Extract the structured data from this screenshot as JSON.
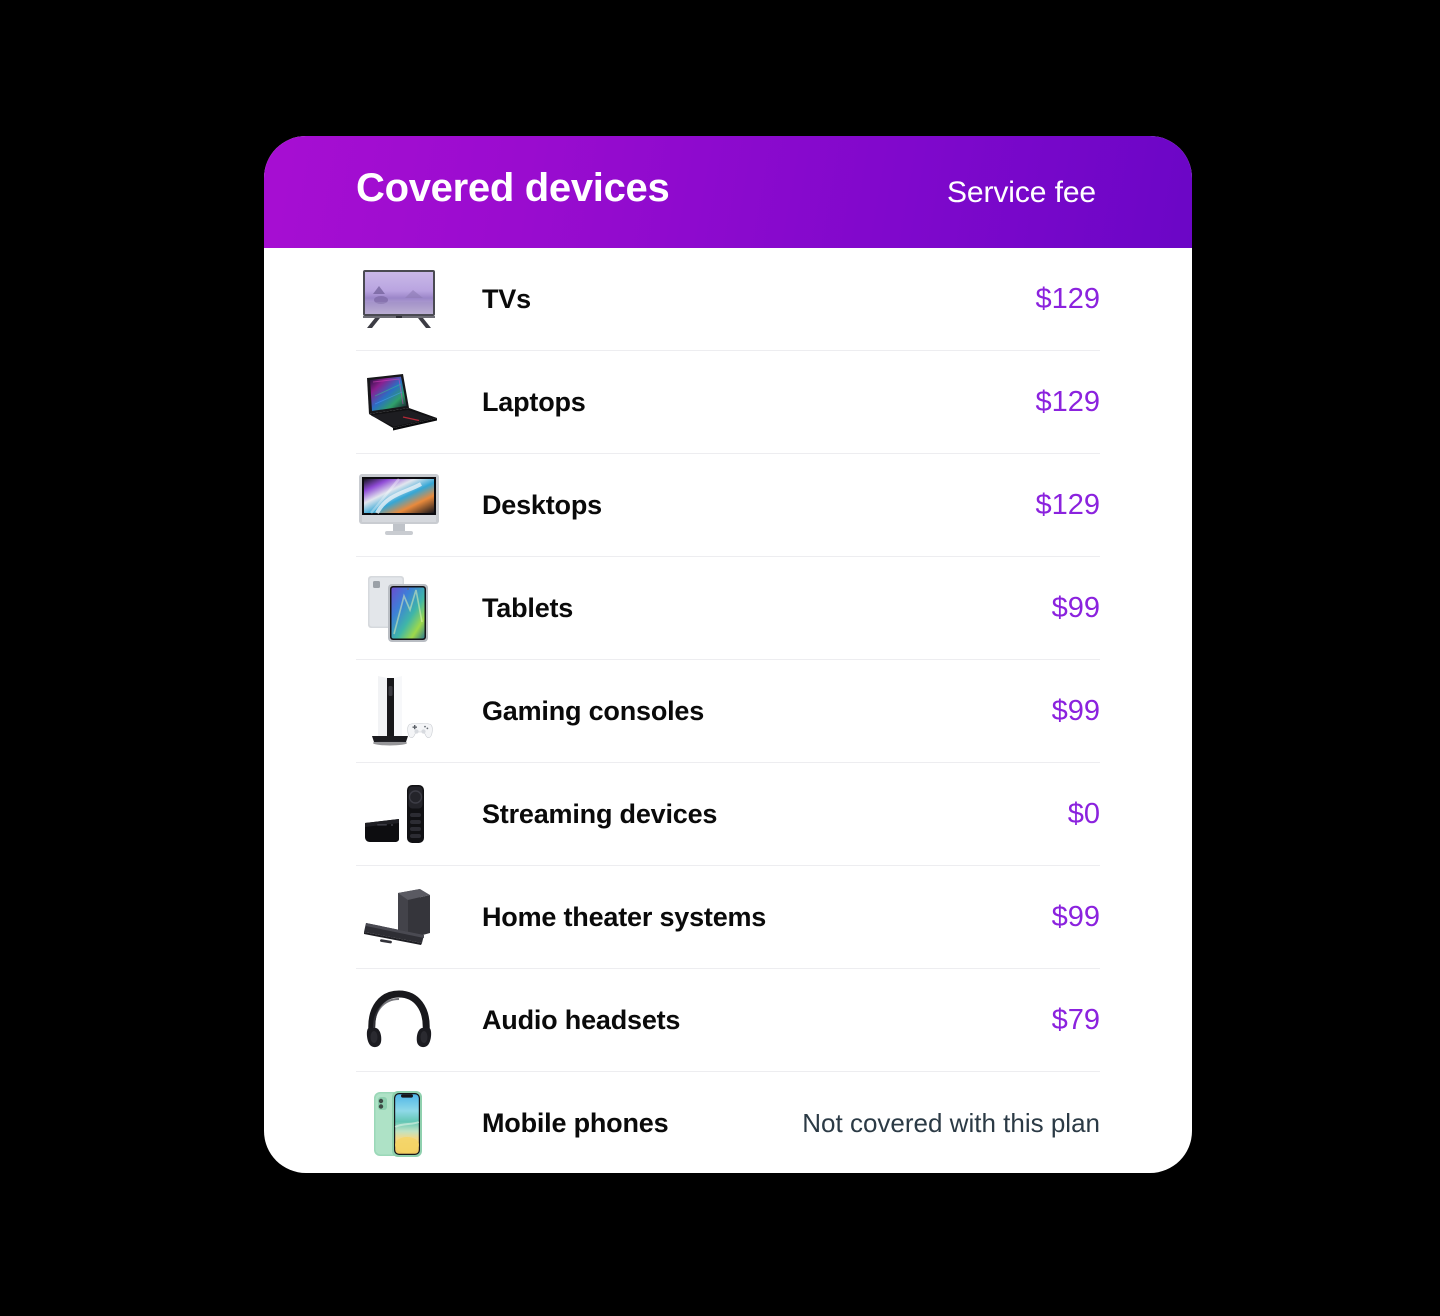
{
  "card": {
    "header": {
      "title": "Covered devices",
      "fee_column_label": "Service fee"
    },
    "accent_color": "#8b22de",
    "header_gradient_start": "#a70ed2",
    "header_gradient_end": "#6b06c6",
    "rows": [
      {
        "icon": "tv-photo",
        "label": "TVs",
        "value": "$129"
      },
      {
        "icon": "laptop-photo",
        "label": "Laptops",
        "value": "$129"
      },
      {
        "icon": "desktop-photo",
        "label": "Desktops",
        "value": "$129"
      },
      {
        "icon": "tablet-photo",
        "label": "Tablets",
        "value": "$99"
      },
      {
        "icon": "game-console-photo",
        "label": "Gaming consoles",
        "value": "$99"
      },
      {
        "icon": "streaming-device-photo",
        "label": "Streaming devices",
        "value": "$0"
      },
      {
        "icon": "home-theater-photo",
        "label": "Home theater systems",
        "value": "$99"
      },
      {
        "icon": "headset-photo",
        "label": "Audio headsets",
        "value": "$79"
      },
      {
        "icon": "mobile-phone-photo",
        "label": "Mobile phones",
        "value": "Not covered with this plan"
      }
    ]
  }
}
